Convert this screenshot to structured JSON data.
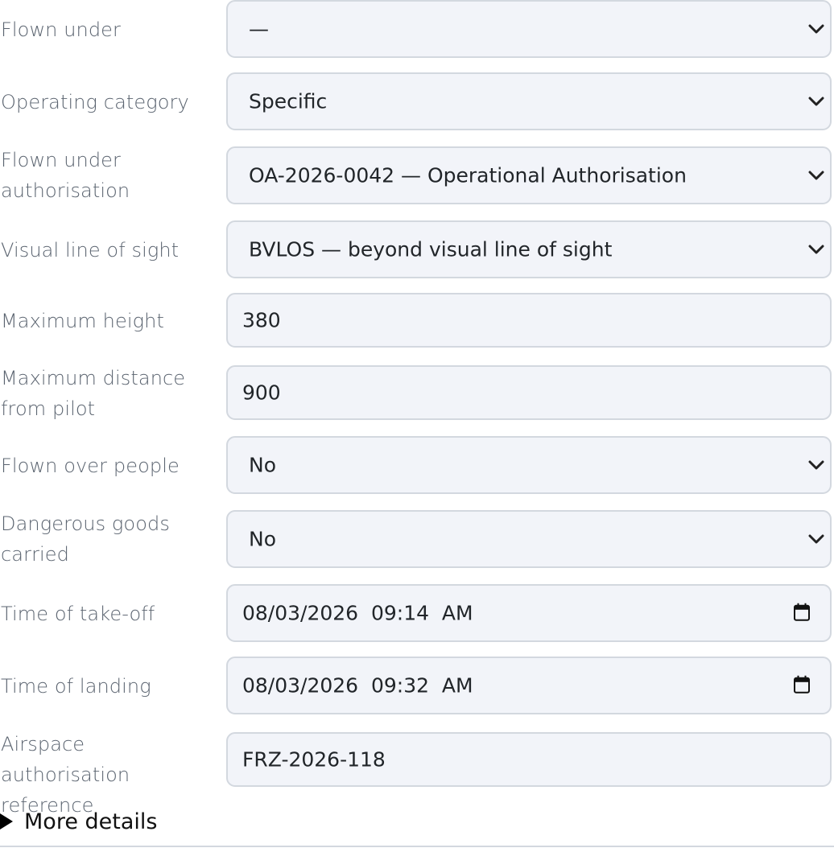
{
  "form": {
    "fields": [
      {
        "label": "Flown under",
        "type": "select",
        "value": "—"
      },
      {
        "label": "Operating category",
        "type": "select",
        "value": "Specific"
      },
      {
        "label": "Flown under authorisation",
        "type": "select",
        "value": "OA-2026-0042 — Operational Authorisation"
      },
      {
        "label": "Visual line of sight",
        "type": "select",
        "value": "BVLOS — beyond visual line of sight"
      },
      {
        "label": "Maximum height",
        "type": "input",
        "value": "380"
      },
      {
        "label": "Maximum distance from pilot",
        "type": "input",
        "value": "900"
      },
      {
        "label": "Flown over people",
        "type": "select",
        "value": "No"
      },
      {
        "label": "Dangerous goods carried",
        "type": "select",
        "value": "No"
      },
      {
        "label": "Time of take-off",
        "type": "datetime",
        "value": "08/03/2026  09:14  AM"
      },
      {
        "label": "Time of landing",
        "type": "datetime",
        "value": "08/03/2026  09:32  AM"
      },
      {
        "label": "Airspace authorisation reference",
        "type": "input",
        "value": "FRZ-2026-118"
      }
    ],
    "more_details_label": "More details"
  },
  "icons": {
    "select_arrow": "chevron-down-icon",
    "datetime": "calendar-icon",
    "disclosure": "disclosure-triangle-icon"
  }
}
